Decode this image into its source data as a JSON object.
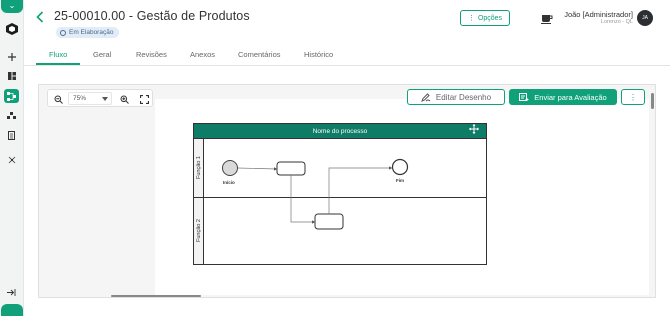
{
  "header": {
    "title": "25-00010.00 - Gestão de Produtos",
    "status": "Em Elaboração",
    "options_label": "Opções",
    "user_name": "João [Administrador]",
    "user_org": "Lorenzo - QL",
    "avatar_initials": "JA"
  },
  "tabs": [
    "Fluxo",
    "Geral",
    "Revisões",
    "Anexos",
    "Comentários",
    "Histórico"
  ],
  "toolbar": {
    "zoom_value": "75%",
    "edit_label": "Editar Desenho",
    "send_label": "Enviar para Avaliação",
    "more_label": "⋮"
  },
  "diagram": {
    "pool_name": "Nome do processo",
    "lane_1": "Função 1",
    "lane_2": "Função 2",
    "start_label": "Início",
    "end_label": "Fim"
  },
  "colors": {
    "accent": "#11a17a",
    "pool_header": "#0e7c66",
    "status_bg": "#e2ecf7"
  }
}
